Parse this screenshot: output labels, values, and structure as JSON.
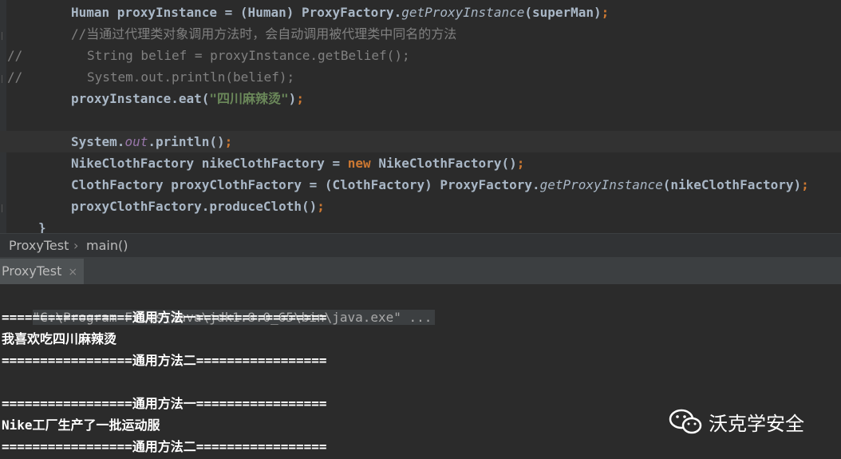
{
  "editor": {
    "lines": [
      {
        "parts": [
          {
            "t": "Human proxyInstance = (Human) ProxyFactory.",
            "c": ""
          },
          {
            "t": "getProxyInstance",
            "c": "method-it"
          },
          {
            "t": "(superMan)",
            "c": ""
          },
          {
            "t": ";",
            "c": "kw"
          }
        ]
      },
      {
        "parts": [
          {
            "t": "//当通过代理类对象调用方法时，会自动调用被代理类中同名的方法",
            "c": "comment"
          }
        ]
      },
      {
        "prefix": "//",
        "parts": [
          {
            "t": "String belief = proxyInstance.getBelief();",
            "c": "comment"
          }
        ]
      },
      {
        "prefix": "//",
        "parts": [
          {
            "t": "System.out.println(belief);",
            "c": "comment"
          }
        ]
      },
      {
        "parts": [
          {
            "t": "proxyInstance.eat(",
            "c": ""
          },
          {
            "t": "\"四川麻辣烫\"",
            "c": "str"
          },
          {
            "t": ")",
            "c": ""
          },
          {
            "t": ";",
            "c": "kw"
          }
        ]
      },
      {
        "parts": []
      },
      {
        "parts": [
          {
            "t": "System.",
            "c": ""
          },
          {
            "t": "out",
            "c": "ital"
          },
          {
            "t": ".println()",
            "c": ""
          },
          {
            "t": ";",
            "c": "kw"
          }
        ]
      },
      {
        "parts": [
          {
            "t": "NikeClothFactory nikeClothFactory = ",
            "c": ""
          },
          {
            "t": "new",
            "c": "kw"
          },
          {
            "t": " NikeClothFactory()",
            "c": ""
          },
          {
            "t": ";",
            "c": "kw"
          }
        ]
      },
      {
        "parts": [
          {
            "t": "ClothFactory proxyClothFactory = (ClothFactory) ProxyFactory.",
            "c": ""
          },
          {
            "t": "getProxyInstance",
            "c": "method-it"
          },
          {
            "t": "(nikeClothFactory)",
            "c": ""
          },
          {
            "t": ";",
            "c": "kw"
          }
        ]
      },
      {
        "parts": [
          {
            "t": "proxyClothFactory.produceCloth()",
            "c": ""
          },
          {
            "t": ";",
            "c": "kw"
          }
        ]
      },
      {
        "parts": [
          {
            "t": "}",
            "c": ""
          }
        ]
      }
    ]
  },
  "breadcrumb": {
    "class_name": "ProxyTest",
    "separator": "›",
    "method_name": "main()"
  },
  "run_panel": {
    "tab_label": "ProxyTest",
    "close_label": "×"
  },
  "console": {
    "command": "\"C:\\Program Files\\Java\\jdk1.8.0_65\\bin\\java.exe\" ...",
    "lines": [
      "=================通用方法一=================",
      "我喜欢吃四川麻辣烫",
      "=================通用方法二=================",
      "",
      "=================通用方法一=================",
      "Nike工厂生产了一批运动服",
      "=================通用方法二================="
    ]
  },
  "watermark": {
    "text": "沃克学安全",
    "icon": "wechat-icon"
  },
  "colors": {
    "background": "#2b2b2b",
    "keyword": "#cc7832",
    "string": "#6a8759",
    "comment": "#808080",
    "field": "#9876aa",
    "text": "#a9b7c6"
  }
}
